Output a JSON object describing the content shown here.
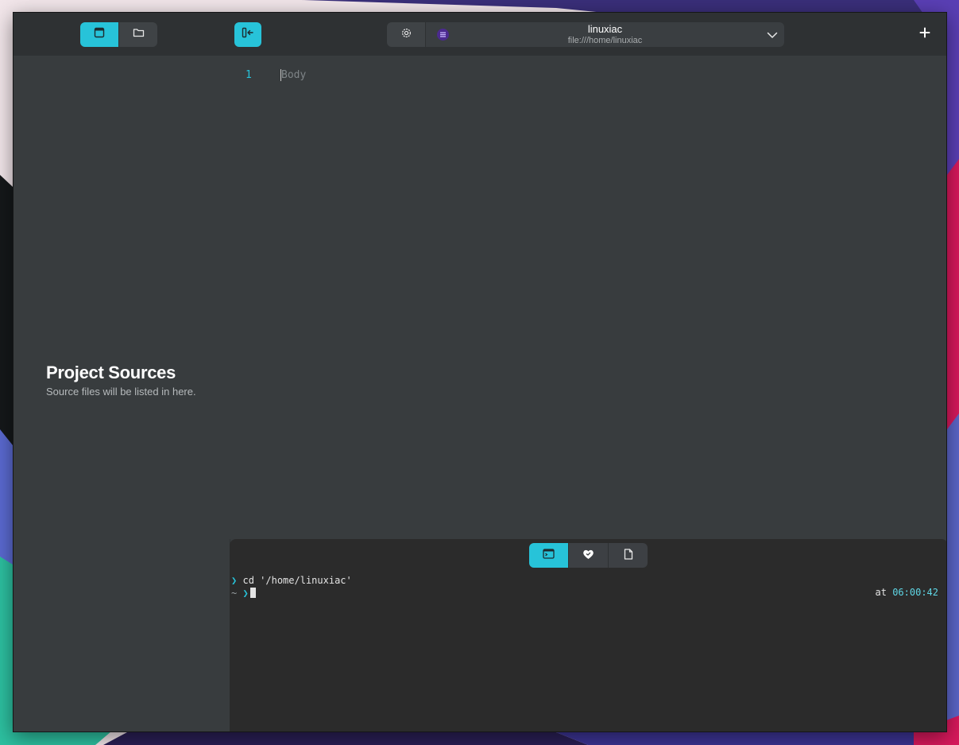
{
  "sidebar": {
    "switcher": [
      {
        "name": "window-icon",
        "active": true
      },
      {
        "name": "folder-icon",
        "active": false
      }
    ],
    "placeholder": {
      "title": "Project Sources",
      "description": "Source files will be listed in here."
    }
  },
  "header": {
    "doc_title": "linuxiac",
    "doc_path": "file:///home/linuxiac",
    "icons": [
      "toggle-sidebar-icon",
      "settings-icon",
      "document-icon",
      "chevron-down-icon",
      "plus-icon"
    ]
  },
  "editor": {
    "line_number": "1",
    "placeholder": "Body"
  },
  "terminal": {
    "tabs": [
      {
        "name": "terminal-icon",
        "active": true
      },
      {
        "name": "heart-icon",
        "active": false
      },
      {
        "name": "file-icon",
        "active": false
      }
    ],
    "arrow": "❯",
    "command": "cd '/home/linuxiac'",
    "prompt_dir": "~",
    "at_label": "at",
    "time": "06:00:42"
  },
  "colors": {
    "accent": "#27c3d9",
    "sidebar_bg": "#383c3e",
    "header_bg": "#2e3133",
    "terminal_bg": "#2b2b2b"
  }
}
